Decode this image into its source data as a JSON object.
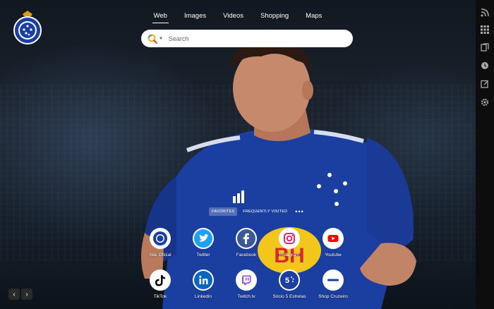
{
  "nav": {
    "items": [
      {
        "label": "Web",
        "active": true
      },
      {
        "label": "Images",
        "active": false
      },
      {
        "label": "Videos",
        "active": false
      },
      {
        "label": "Shopping",
        "active": false
      },
      {
        "label": "Maps",
        "active": false
      }
    ]
  },
  "search": {
    "placeholder": "Search",
    "value": ""
  },
  "favorites": {
    "tabs": [
      {
        "label": "FAVORITES",
        "active": true
      },
      {
        "label": "FREQUENTLY VISITED",
        "active": false
      }
    ],
    "more": "•••"
  },
  "tiles": [
    {
      "label": "Site Oficial",
      "icon": "cruzeiro-crest-icon",
      "color": "#1b3fa0"
    },
    {
      "label": "Twitter",
      "icon": "twitter-icon",
      "color": "#1da1f2"
    },
    {
      "label": "Facebook",
      "icon": "facebook-icon",
      "color": "#3b5998"
    },
    {
      "label": "Instagram",
      "icon": "instagram-icon",
      "color": "#d62976"
    },
    {
      "label": "Youtube",
      "icon": "youtube-icon",
      "color": "#ff0000"
    },
    {
      "label": "TikTok",
      "icon": "tiktok-icon",
      "color": "#000000"
    },
    {
      "label": "Linkedin",
      "icon": "linkedin-icon",
      "color": "#0a66c2"
    },
    {
      "label": "Twitch.tv",
      "icon": "twitch-icon",
      "color": "#9146ff"
    },
    {
      "label": "Sócio 5 Estrelas",
      "icon": "socio-5-estrelas-icon",
      "color": "#1b3fa0"
    },
    {
      "label": "Shop Cruzeiro",
      "icon": "shop-cruzeiro-icon",
      "color": "#1b3fa0"
    }
  ],
  "sidebar": {
    "icons": [
      "rss-icon",
      "apps-grid-icon",
      "bookmarks-icon",
      "history-icon",
      "notes-icon",
      "settings-icon"
    ]
  },
  "pager": {
    "prev": "‹",
    "next": "›"
  },
  "colors": {
    "jersey": "#1b3fa0",
    "sidebar": "#0d0d0d"
  }
}
